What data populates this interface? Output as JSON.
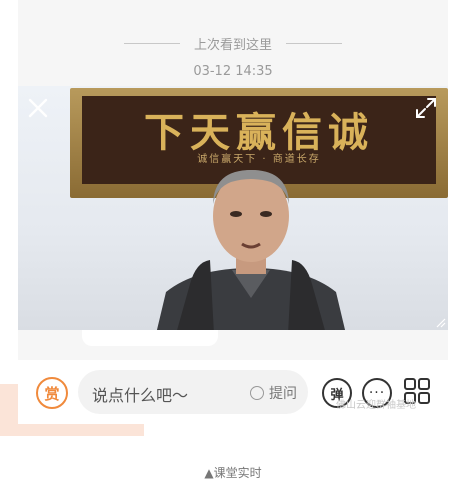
{
  "history": {
    "divider_label": "上次看到这里",
    "timestamp": "03-12 14:35"
  },
  "video": {
    "plaque_text": "下天赢信诚",
    "plaque_inscription": "诚信赢天下 · 商道长存",
    "close_icon": "close-icon",
    "expand_icon": "expand-icon"
  },
  "bottom_bar": {
    "reward_label": "赏",
    "comment_placeholder": "说点什么吧～",
    "ask_label": "提问",
    "danmaku_label": "弹",
    "more_label": "···",
    "apps_icon": "grid-icon"
  },
  "watermark": "佛山云迎群袖基地",
  "footer": {
    "label": "▲课堂实时"
  },
  "colors": {
    "accent": "#f08a3c",
    "background": "#f6f6f6",
    "muted_text": "#9a9a9a"
  }
}
